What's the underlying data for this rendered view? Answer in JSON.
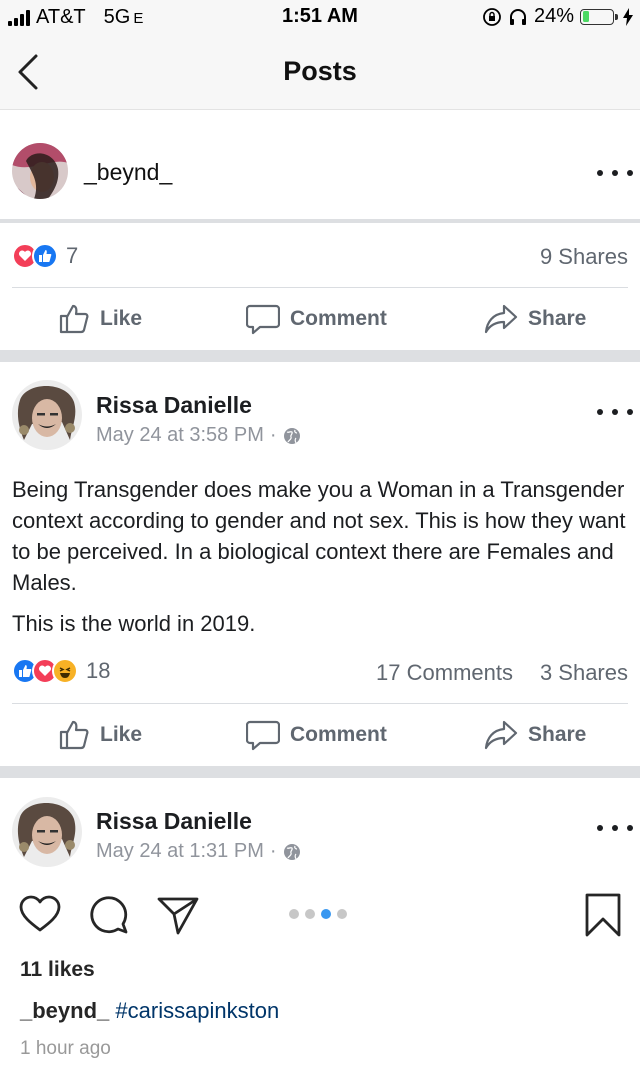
{
  "status_bar": {
    "carrier": "AT&T",
    "network": "5G",
    "network_suffix": "E",
    "time": "1:51 AM",
    "battery": "24%",
    "battery_level": 0.24,
    "icons": [
      "signal-icon",
      "rotation-lock-icon",
      "headphones-icon",
      "battery-icon",
      "charging-bolt-icon"
    ]
  },
  "nav": {
    "title": "Posts",
    "back_icon": "chevron-left-icon"
  },
  "shared_post": {
    "username": "_beynd_",
    "reactions_count": "7",
    "reaction_icons": [
      "heart-icon",
      "like-icon"
    ],
    "shares": "9 Shares",
    "actions": {
      "like": "Like",
      "comment": "Comment",
      "share": "Share"
    }
  },
  "fb_post": {
    "author": "Rissa Danielle",
    "timestamp": "May 24 at 3:58 PM",
    "privacy_icon": "globe-icon",
    "text_paragraph1": "Being Transgender does make you a Woman in a Transgender context according to gender and not sex. This is how they want to be perceived. In a biological context there are Females and Males.",
    "text_paragraph2": "This is the world in 2019.",
    "reactions_count": "18",
    "reaction_icons": [
      "like-icon",
      "heart-icon",
      "laugh-icon"
    ],
    "comments": "17 Comments",
    "shares": "3 Shares",
    "actions": {
      "like": "Like",
      "comment": "Comment",
      "share": "Share"
    }
  },
  "fb_post2": {
    "author": "Rissa Danielle",
    "timestamp": "May 24 at 1:31 PM",
    "privacy_icon": "globe-icon"
  },
  "ig": {
    "likes": "11 likes",
    "caption_user": "_beynd_",
    "caption_tag": "#carissapinkston",
    "time_ago": "1 hour ago",
    "carousel_count": 4,
    "carousel_active": 3
  },
  "colors": {
    "like_blue": "#1877f2",
    "heart_red": "#f33e58",
    "haha_yellow": "#f7b125",
    "ig_active_dot": "#3897f0",
    "divider": "#dddfe2"
  }
}
